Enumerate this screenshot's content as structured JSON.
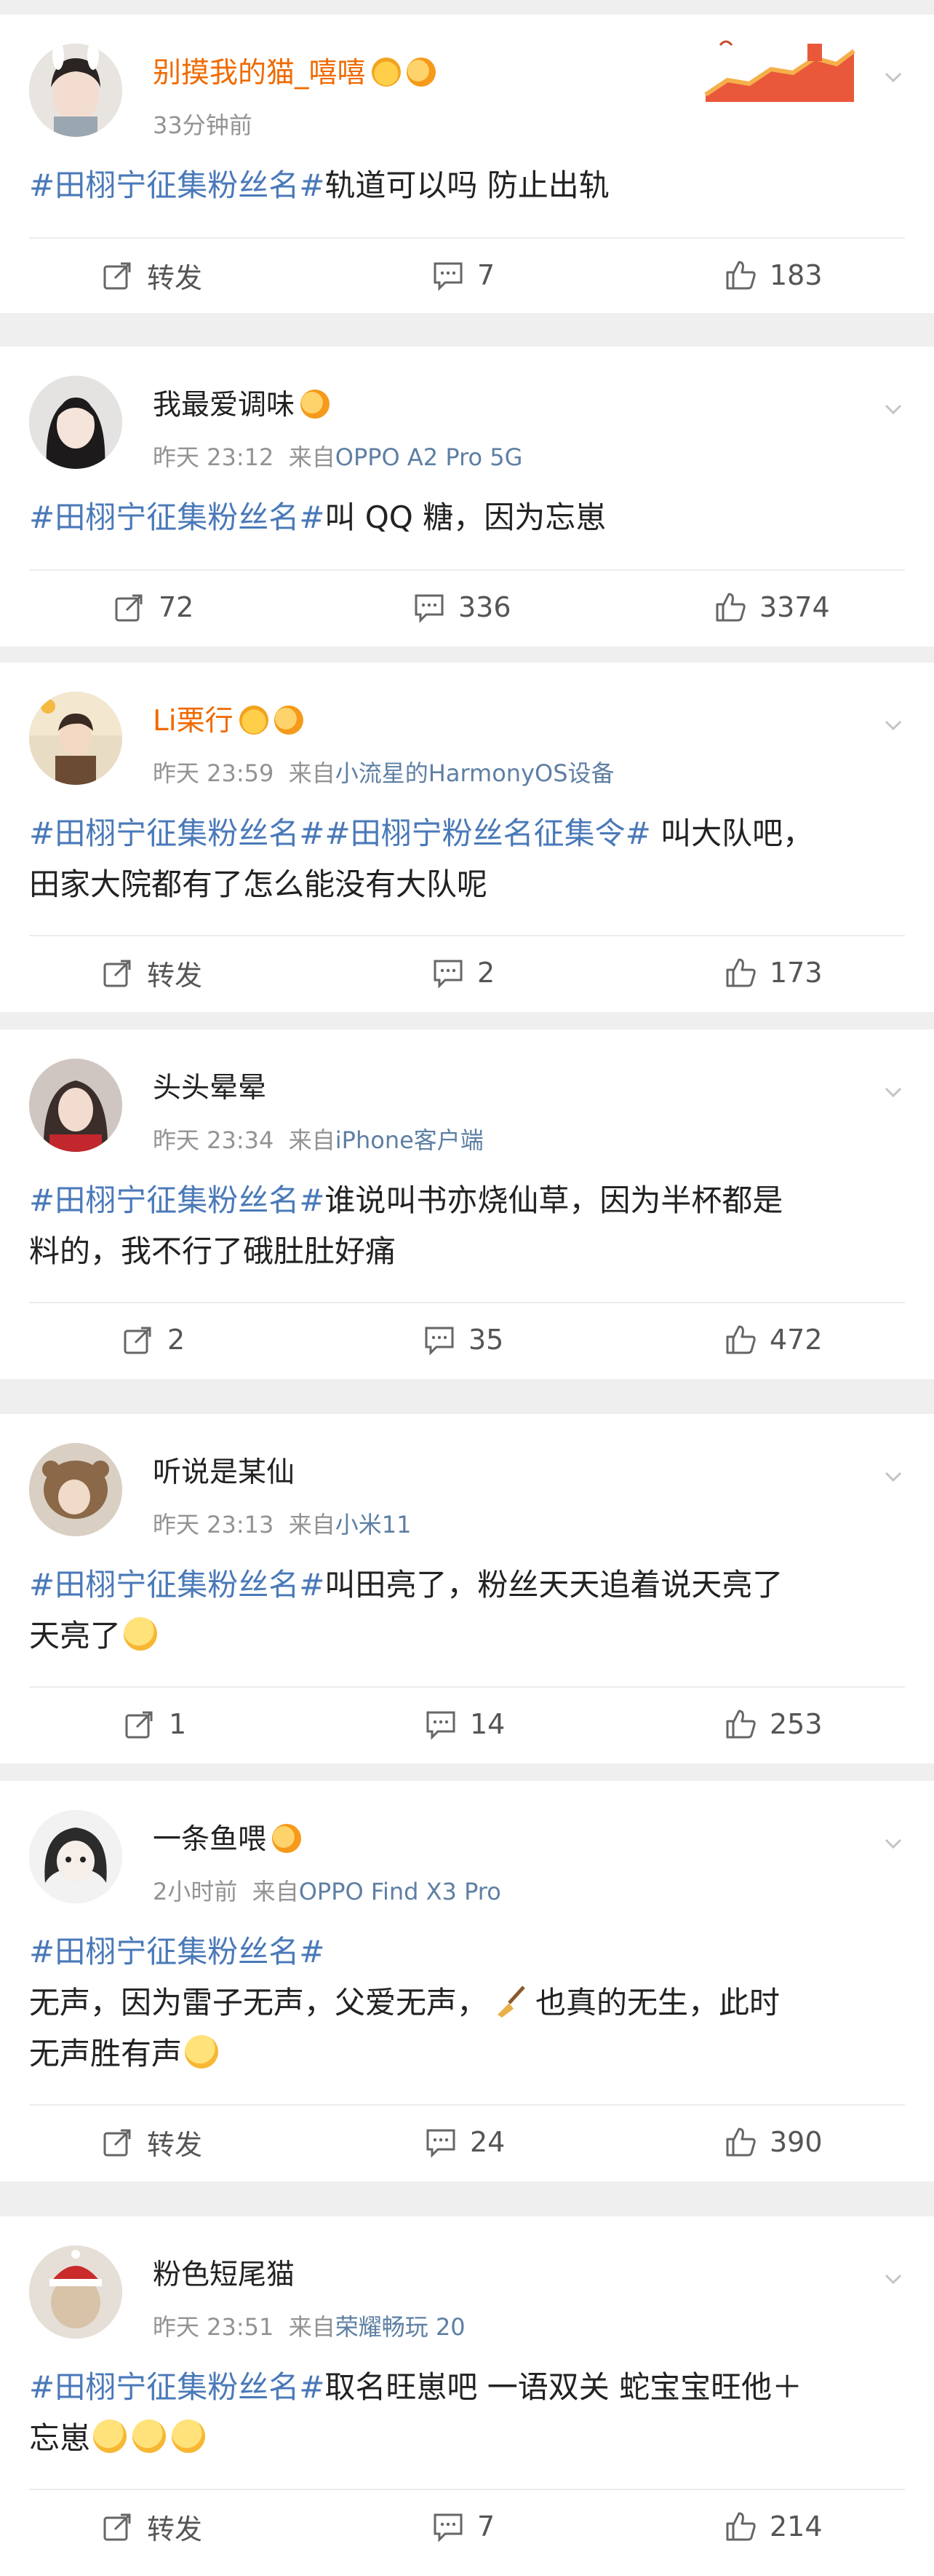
{
  "colors": {
    "hashtag": "#4a79b8",
    "vip_name": "#f06a00",
    "meta": "#939393",
    "source": "#5e7fa3",
    "background": "#efefef"
  },
  "posts": [
    {
      "username": "别摸我的猫_嘻嘻",
      "time": "33分钟前",
      "source_prefix": "",
      "source": "",
      "lines": [
        {
          "tag": "#田栩宁征集粉丝名#",
          "text": "轨道可以吗 防止出轨"
        }
      ],
      "share": "转发",
      "comments": "7",
      "likes": "183"
    },
    {
      "username": "我最爱调味",
      "time": "昨天 23:12",
      "source_prefix": "来自",
      "source": "OPPO A2 Pro 5G",
      "lines": [
        {
          "tag": "#田栩宁征集粉丝名#",
          "text": "叫 QQ 糖，因为忘崽"
        }
      ],
      "share": "72",
      "comments": "336",
      "likes": "3374"
    },
    {
      "username": "Li栗行",
      "time": "昨天 23:59",
      "source_prefix": "来自",
      "source": "小流星的HarmonyOS设备",
      "lines": [
        {
          "tag": "#田栩宁征集粉丝名##田栩宁粉丝名征集令#",
          "text": " 叫大队吧，"
        },
        {
          "tag": "",
          "text": "田家大院都有了怎么能没有大队呢"
        }
      ],
      "share": "转发",
      "comments": "2",
      "likes": "173"
    },
    {
      "username": "头头晕晕",
      "time": "昨天 23:34",
      "source_prefix": "来自",
      "source": "iPhone客户端",
      "lines": [
        {
          "tag": "#田栩宁征集粉丝名#",
          "text": "谁说叫书亦烧仙草，因为半杯都是"
        },
        {
          "tag": "",
          "text": "料的，我不行了硪肚肚好痛"
        }
      ],
      "share": "2",
      "comments": "35",
      "likes": "472"
    },
    {
      "username": "听说是某仙",
      "time": "昨天 23:13",
      "source_prefix": "来自",
      "source": "小米11",
      "lines": [
        {
          "tag": "#田栩宁征集粉丝名#",
          "text": "叫田亮了，粉丝天天追着说天亮了"
        },
        {
          "tag": "",
          "text": "天亮了"
        }
      ],
      "share": "1",
      "comments": "14",
      "likes": "253"
    },
    {
      "username": "一条鱼喂",
      "time": "2小时前",
      "source_prefix": "来自",
      "source": "OPPO Find X3 Pro",
      "lines": [
        {
          "tag": "#田栩宁征集粉丝名#",
          "text": ""
        },
        {
          "tag": "",
          "text": "无声，因为雷子无声，父爱无声，"
        },
        {
          "tag": "",
          "text": "无声胜有声"
        }
      ],
      "line2_tail": "也真的无生，此时",
      "share": "转发",
      "comments": "24",
      "likes": "390"
    },
    {
      "username": "粉色短尾猫",
      "time": "昨天 23:51",
      "source_prefix": "来自",
      "source": "荣耀畅玩 20",
      "lines": [
        {
          "tag": "#田栩宁征集粉丝名#",
          "text": "取名旺崽吧 一语双关 蛇宝宝旺他＋"
        },
        {
          "tag": "",
          "text": "忘崽"
        }
      ],
      "share": "转发",
      "comments": "7",
      "likes": "214"
    }
  ]
}
